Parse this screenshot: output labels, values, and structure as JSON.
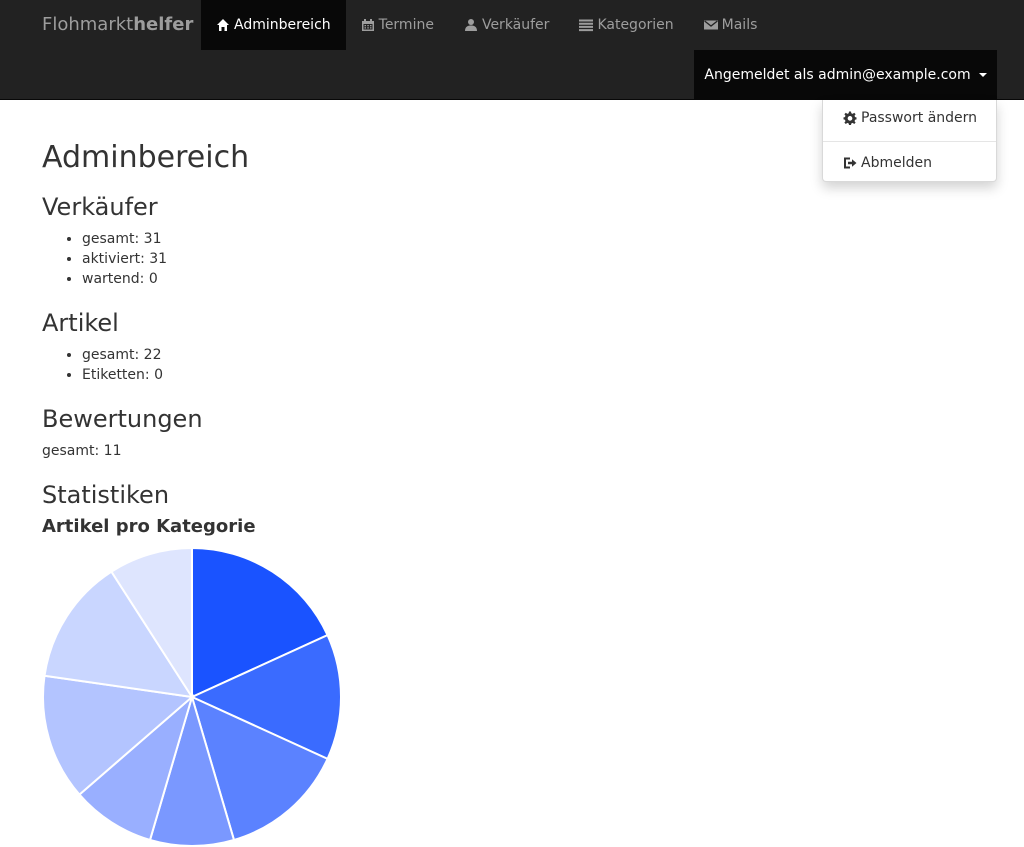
{
  "navbar": {
    "brand": {
      "light": "Flohmarkt",
      "bold": "helfer"
    },
    "items": [
      {
        "label": "Adminbereich",
        "icon": "home-icon",
        "active": true
      },
      {
        "label": "Termine",
        "icon": "calendar-icon",
        "active": false
      },
      {
        "label": "Verkäufer",
        "icon": "user-icon",
        "active": false
      },
      {
        "label": "Kategorien",
        "icon": "list-icon",
        "active": false
      },
      {
        "label": "Mails",
        "icon": "envelope-icon",
        "active": false
      }
    ],
    "user_menu": {
      "label": "Angemeldet als admin@example.com",
      "items": [
        {
          "label": "Passwort ändern",
          "icon": "gear-icon"
        },
        {
          "label": "Abmelden",
          "icon": "logout-icon"
        }
      ]
    }
  },
  "page": {
    "title": "Adminbereich",
    "sellers": {
      "heading": "Verkäufer",
      "items": [
        "gesamt: 31",
        "aktiviert: 31",
        "wartend: 0"
      ]
    },
    "articles": {
      "heading": "Artikel",
      "items": [
        "gesamt: 22",
        "Etiketten: 0"
      ]
    },
    "ratings": {
      "heading": "Bewertungen",
      "text": "gesamt: 11"
    },
    "statistics": {
      "heading": "Statistiken",
      "subheading": "Artikel pro Kategorie"
    }
  },
  "colors": {
    "navbar_bg": "#222222",
    "navbar_active": "#080808",
    "accent": "#1a53ff"
  },
  "chart_data": {
    "type": "pie",
    "title": "",
    "values": [
      4,
      3,
      3,
      2,
      2,
      3,
      3,
      2
    ],
    "colors": [
      "#1a53ff",
      "#3a6bff",
      "#5b82ff",
      "#7a98ff",
      "#99afff",
      "#b3c4ff",
      "#c9d6ff",
      "#dee5fe"
    ]
  }
}
